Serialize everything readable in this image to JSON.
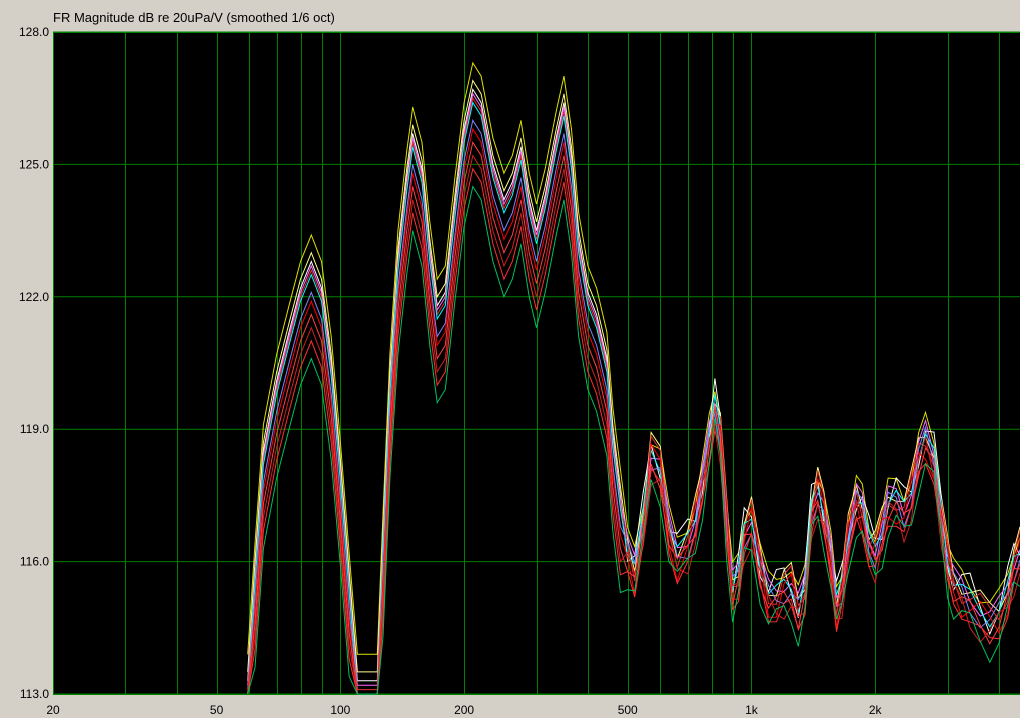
{
  "chart_data": {
    "type": "line",
    "title": "FR Magnitude dB re 20uPa/V (smoothed 1/6 oct)",
    "x_scale": "log",
    "xlim": [
      20,
      4500
    ],
    "ylim": [
      113,
      128
    ],
    "grid": true,
    "background": "#000000",
    "grid_color": "#008000",
    "y_ticks": [
      {
        "value": 113,
        "label": "113.0"
      },
      {
        "value": 116,
        "label": "116.0"
      },
      {
        "value": 119,
        "label": "119.0"
      },
      {
        "value": 122,
        "label": "122.0"
      },
      {
        "value": 125,
        "label": "125.0"
      },
      {
        "value": 128,
        "label": "128.0"
      }
    ],
    "x_ticks": [
      {
        "value": 20,
        "label": "20"
      },
      {
        "value": 50,
        "label": "50"
      },
      {
        "value": 100,
        "label": "100"
      },
      {
        "value": 200,
        "label": "200"
      },
      {
        "value": 500,
        "label": "500"
      },
      {
        "value": 1000,
        "label": "1k"
      },
      {
        "value": 2000,
        "label": "2k"
      }
    ],
    "x_minor_ticks": [
      30,
      40,
      60,
      70,
      80,
      90,
      300,
      400,
      600,
      700,
      800,
      900,
      3000,
      4000
    ],
    "base_curve": [
      [
        59.5,
        113.0
      ],
      [
        62,
        115.5
      ],
      [
        65,
        118.2
      ],
      [
        70,
        119.8
      ],
      [
        75,
        120.9
      ],
      [
        80,
        121.9
      ],
      [
        85,
        122.5
      ],
      [
        90,
        121.9
      ],
      [
        95,
        120.2
      ],
      [
        100,
        117.8
      ],
      [
        105,
        115.3
      ],
      [
        110,
        113.0
      ],
      [
        123,
        113.0
      ],
      [
        127,
        116.2
      ],
      [
        132,
        119.8
      ],
      [
        138,
        122.6
      ],
      [
        145,
        124.4
      ],
      [
        150,
        125.4
      ],
      [
        158,
        124.6
      ],
      [
        165,
        122.8
      ],
      [
        172,
        121.5
      ],
      [
        180,
        121.8
      ],
      [
        190,
        123.8
      ],
      [
        200,
        125.5
      ],
      [
        210,
        126.4
      ],
      [
        220,
        126.1
      ],
      [
        235,
        124.7
      ],
      [
        250,
        123.9
      ],
      [
        262,
        124.3
      ],
      [
        275,
        125.1
      ],
      [
        288,
        123.9
      ],
      [
        300,
        123.2
      ],
      [
        315,
        124.0
      ],
      [
        335,
        125.3
      ],
      [
        350,
        126.1
      ],
      [
        365,
        124.9
      ],
      [
        380,
        123.0
      ],
      [
        400,
        121.8
      ],
      [
        420,
        121.3
      ],
      [
        445,
        120.3
      ],
      [
        460,
        118.6
      ],
      [
        480,
        117.2
      ],
      [
        500,
        116.3
      ],
      [
        520,
        115.9
      ],
      [
        545,
        117.0
      ],
      [
        570,
        118.5
      ],
      [
        600,
        118.2
      ],
      [
        630,
        116.8
      ],
      [
        660,
        116.2
      ],
      [
        700,
        116.5
      ],
      [
        730,
        117.0
      ],
      [
        760,
        117.9
      ],
      [
        790,
        118.9
      ],
      [
        815,
        119.6
      ],
      [
        840,
        119.0
      ],
      [
        870,
        117.0
      ],
      [
        900,
        115.5
      ],
      [
        930,
        115.8
      ],
      [
        960,
        116.7
      ],
      [
        1000,
        117.0
      ],
      [
        1050,
        116.0
      ],
      [
        1100,
        115.3
      ],
      [
        1150,
        115.3
      ],
      [
        1200,
        115.5
      ],
      [
        1250,
        115.5
      ],
      [
        1300,
        115.0
      ],
      [
        1350,
        115.5
      ],
      [
        1400,
        117.2
      ],
      [
        1450,
        117.7
      ],
      [
        1500,
        117.2
      ],
      [
        1560,
        116.2
      ],
      [
        1610,
        115.1
      ],
      [
        1660,
        115.5
      ],
      [
        1720,
        116.6
      ],
      [
        1800,
        117.5
      ],
      [
        1860,
        117.3
      ],
      [
        1930,
        116.5
      ],
      [
        2000,
        116.3
      ],
      [
        2080,
        116.8
      ],
      [
        2150,
        117.4
      ],
      [
        2250,
        117.5
      ],
      [
        2350,
        117.2
      ],
      [
        2450,
        117.6
      ],
      [
        2550,
        118.5
      ],
      [
        2650,
        118.9
      ],
      [
        2780,
        118.4
      ],
      [
        2900,
        117.1
      ],
      [
        3000,
        116.1
      ],
      [
        3100,
        115.6
      ],
      [
        3250,
        115.4
      ],
      [
        3400,
        115.2
      ],
      [
        3600,
        114.9
      ],
      [
        3800,
        114.7
      ],
      [
        4000,
        114.9
      ],
      [
        4200,
        115.4
      ],
      [
        4350,
        116.0
      ],
      [
        4500,
        116.3
      ]
    ],
    "series": [
      {
        "color": "#e0e000",
        "offset": 0.9
      },
      {
        "color": "#ffff80",
        "offset": 0.5
      },
      {
        "color": "#ffffff",
        "offset": 0.3
      },
      {
        "color": "#ff66ff",
        "offset": 0.2
      },
      {
        "color": "#e03030",
        "offset": 0.1
      },
      {
        "color": "#00ffff",
        "offset": 0.0
      },
      {
        "color": "#8080ff",
        "offset": -0.4
      },
      {
        "color": "#ff0000",
        "offset": -0.6
      },
      {
        "color": "#ff4040",
        "offset": -0.9
      },
      {
        "color": "#cc2020",
        "offset": -1.2
      },
      {
        "color": "#ff3030",
        "offset": -1.5
      },
      {
        "color": "#00c060",
        "offset": -1.9
      }
    ]
  }
}
